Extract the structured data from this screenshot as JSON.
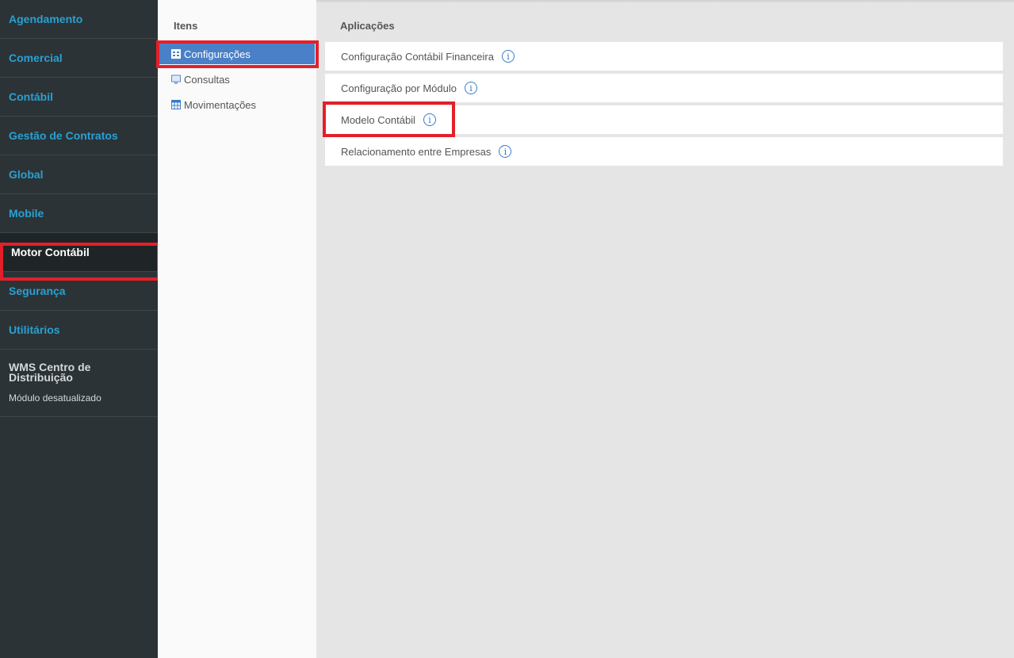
{
  "modules": [
    {
      "label": "Agendamento"
    },
    {
      "label": "Comercial"
    },
    {
      "label": "Contábil"
    },
    {
      "label": "Gestão de Contratos"
    },
    {
      "label": "Global"
    },
    {
      "label": "Mobile"
    },
    {
      "label": "Motor Contábil"
    },
    {
      "label": "Segurança"
    },
    {
      "label": "Utilitários"
    }
  ],
  "wms": {
    "title": "WMS Centro de Distribuição",
    "status": "Módulo desatualizado"
  },
  "items": {
    "heading": "Itens",
    "list": [
      {
        "label": "Configurações",
        "icon": "table-icon"
      },
      {
        "label": "Consultas",
        "icon": "monitor-icon"
      },
      {
        "label": "Movimentações",
        "icon": "grid-icon"
      }
    ]
  },
  "apps": {
    "heading": "Aplicações",
    "list": [
      {
        "label": "Configuração Contábil Financeira",
        "info": "i"
      },
      {
        "label": "Configuração por Módulo",
        "info": "i"
      },
      {
        "label": "Modelo Contábil",
        "info": "i"
      },
      {
        "label": "Relacionamento entre Empresas",
        "info": "i"
      }
    ]
  },
  "colors": {
    "accent": "#2aa0d2",
    "selected": "#4a80c8",
    "highlight": "#e3202a",
    "sidebar": "#2b3336"
  }
}
